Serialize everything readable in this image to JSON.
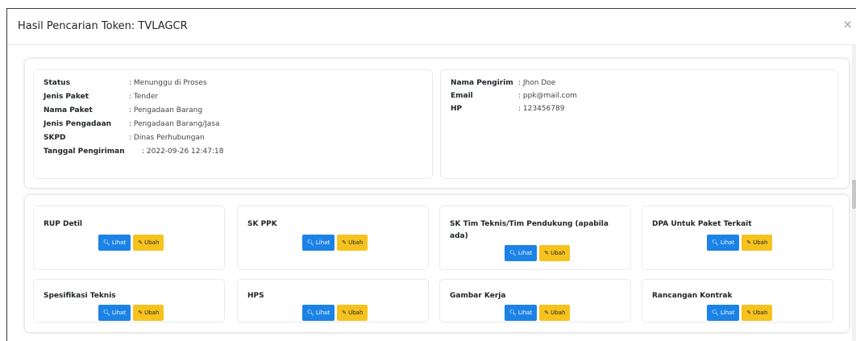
{
  "modal": {
    "title": "Hasil Pencarian Token: TVLAGCR",
    "close": "×"
  },
  "info_left": [
    {
      "label": "Status",
      "value": ": Menunggu di Proses"
    },
    {
      "label": "Jenis Paket",
      "value": ": Tender"
    },
    {
      "label": "Nama Paket",
      "value": ": Pengadaan Barang"
    },
    {
      "label": "Jenis Pengadaan",
      "value": ": Pengadaan Barang/Jasa"
    },
    {
      "label": "SKPD",
      "value": ": Dinas Perhubungan"
    },
    {
      "label": "Tanggal Pengiriman",
      "value": ": 2022-09-26 12:47:18"
    }
  ],
  "info_right": [
    {
      "label": "Nama Pengirim",
      "value": ": Jhon Doe"
    },
    {
      "label": "Email",
      "value": ": ppk@mail.com"
    },
    {
      "label": "HP",
      "value": ": 123456789"
    }
  ],
  "buttons": {
    "lihat": "Lihat",
    "ubah": "Ubah",
    "lihat_icon": "search-icon",
    "ubah_icon": "pencil-icon"
  },
  "documents": [
    {
      "title": "RUP Detil"
    },
    {
      "title": "SK PPK"
    },
    {
      "title": "SK Tim Teknis/Tim Pendukung (apabila ada)"
    },
    {
      "title": "DPA Untuk Paket Terkait"
    },
    {
      "title": "Spesifikasi Teknis"
    },
    {
      "title": "HPS"
    },
    {
      "title": "Gambar Kerja"
    },
    {
      "title": "Rancangan Kontrak"
    }
  ],
  "colors": {
    "primary": "#1b82e6",
    "warning": "#f6c21d"
  }
}
